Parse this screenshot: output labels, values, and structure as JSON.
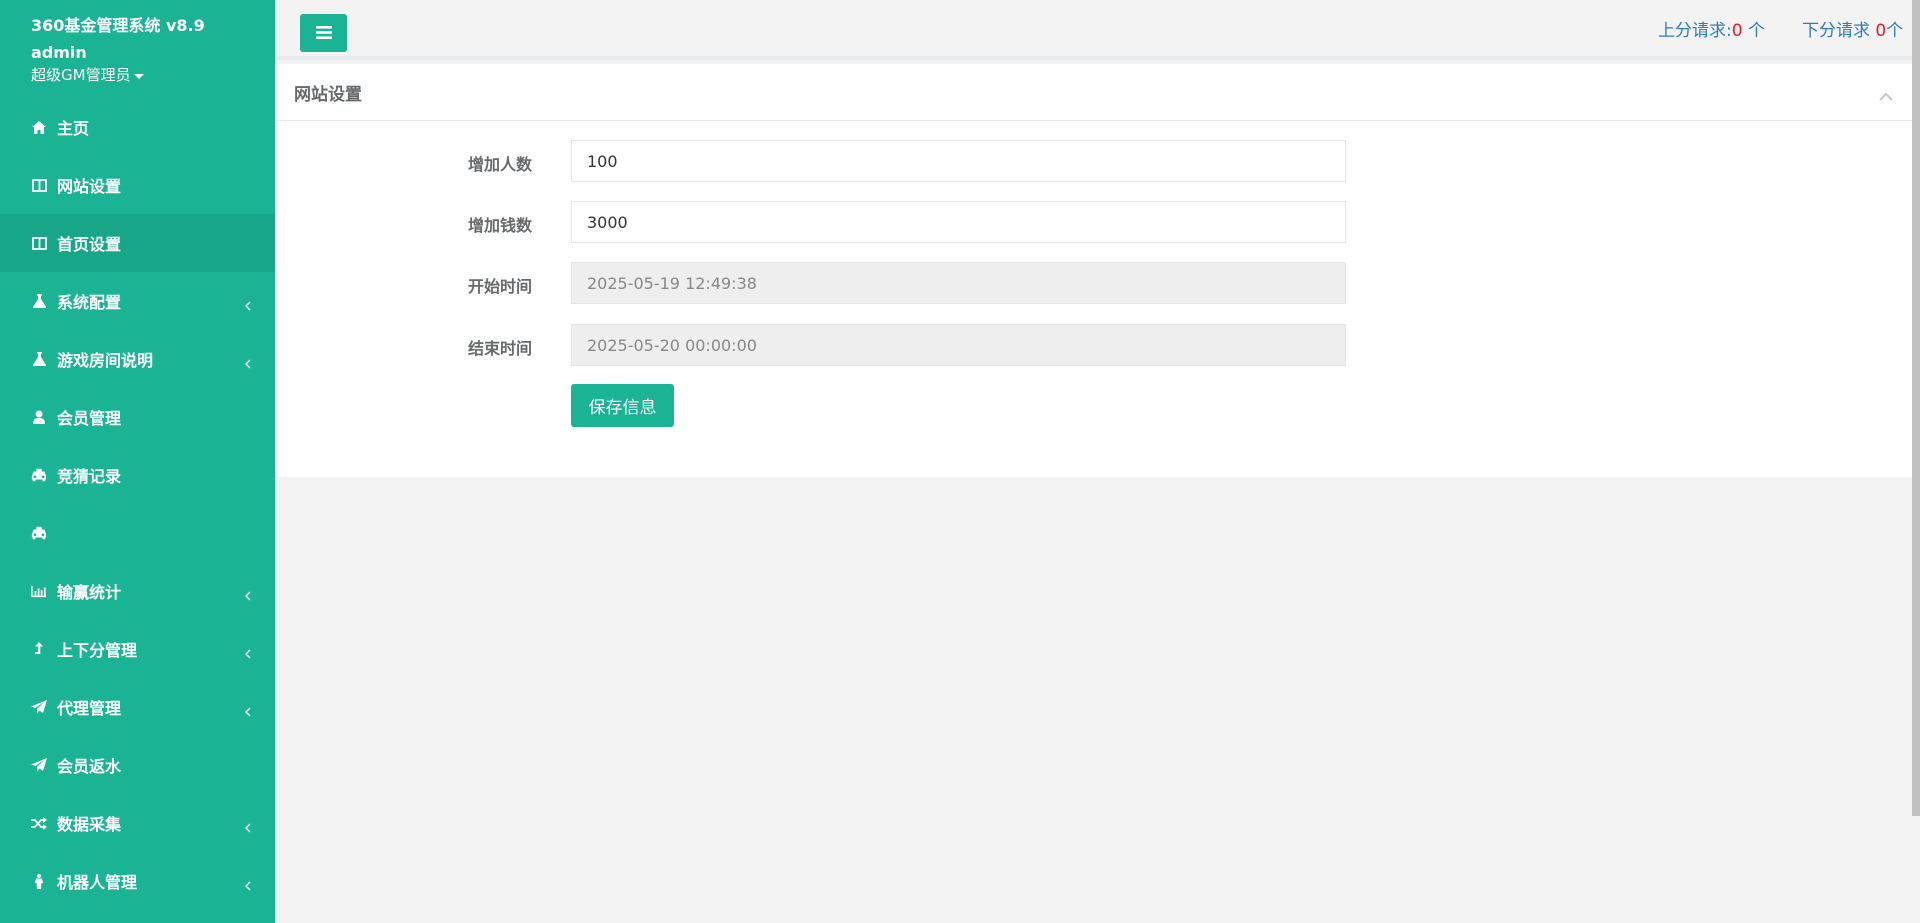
{
  "sidebar": {
    "app_title": "360基金管理系统 v8.9",
    "user_name": "admin",
    "user_role": "超级GM管理员",
    "items": [
      {
        "label": "主页"
      },
      {
        "label": "网站设置"
      },
      {
        "label": "首页设置"
      },
      {
        "label": "系统配置"
      },
      {
        "label": "游戏房间说明"
      },
      {
        "label": "会员管理"
      },
      {
        "label": "竞猜记录"
      },
      {
        "label": ""
      },
      {
        "label": "输赢统计"
      },
      {
        "label": "上下分管理"
      },
      {
        "label": "代理管理"
      },
      {
        "label": "会员返水"
      },
      {
        "label": "数据采集"
      },
      {
        "label": "机器人管理"
      }
    ]
  },
  "topbar": {
    "up_label": "上分请求:",
    "up_count": "0",
    "up_unit": " 个",
    "down_label": "下分请求 ",
    "down_count": "0",
    "down_unit": "个"
  },
  "panel": {
    "title": "网站设置",
    "fields": [
      {
        "label": "增加人数",
        "value": "100"
      },
      {
        "label": "增加钱数",
        "value": "3000"
      },
      {
        "label": "开始时间",
        "value": "2025-05-19 12:49:38"
      },
      {
        "label": "结束时间",
        "value": "2025-05-20 00:00:00"
      }
    ],
    "save_label": "保存信息"
  },
  "colors": {
    "accent": "#1ab394",
    "accent_active": "#18a689",
    "link": "#337ab7",
    "count": "#ed1c24"
  }
}
